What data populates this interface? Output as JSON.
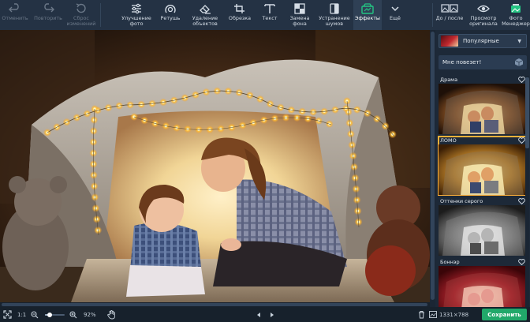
{
  "toolbar": {
    "undo": "Отменить",
    "redo": "Повторить",
    "reset": "Сброс\nизменений",
    "enhance": "Улучшение\nфото",
    "retouch": "Ретушь",
    "remove_objects": "Удаление\nобъектов",
    "crop": "Обрезка",
    "text": "Текст",
    "replace_bg": "Замена\nфона",
    "denoise": "Устранение\nшумов",
    "effects": "Эффекты",
    "more": "Ещё",
    "before_after": "До / после",
    "view_original": "Просмотр\nоригинала",
    "photo_manager": "Фото\nМенеджер"
  },
  "panel": {
    "category": "Популярные",
    "lucky": "Мне повезет!",
    "effects": [
      {
        "name": "Драма",
        "selected": false
      },
      {
        "name": "ЛОМО",
        "selected": true
      },
      {
        "name": "Оттенки серого",
        "selected": false
      },
      {
        "name": "Боннэр",
        "selected": false
      }
    ]
  },
  "status": {
    "ratio": "1:1",
    "zoom": "92%",
    "zoom_fraction": 0.25,
    "dimensions": "1331×788",
    "save": "Сохранить"
  },
  "colors": {
    "accent": "#21a86a",
    "selection": "#ffb13a",
    "toolbar_bg": "#243244"
  },
  "icons": [
    "undo-icon",
    "redo-icon",
    "reset-icon",
    "enhance-icon",
    "retouch-icon",
    "eraser-icon",
    "crop-icon",
    "text-icon",
    "replace-bg-icon",
    "denoise-icon",
    "effects-icon",
    "chevron-down-icon",
    "before-after-icon",
    "eye-icon",
    "photo-manager-icon",
    "dice-icon",
    "heart-icon",
    "fit-icon",
    "zoom-out-icon",
    "zoom-in-icon",
    "hand-icon",
    "prev-icon",
    "next-icon",
    "trash-icon",
    "image-size-icon"
  ]
}
